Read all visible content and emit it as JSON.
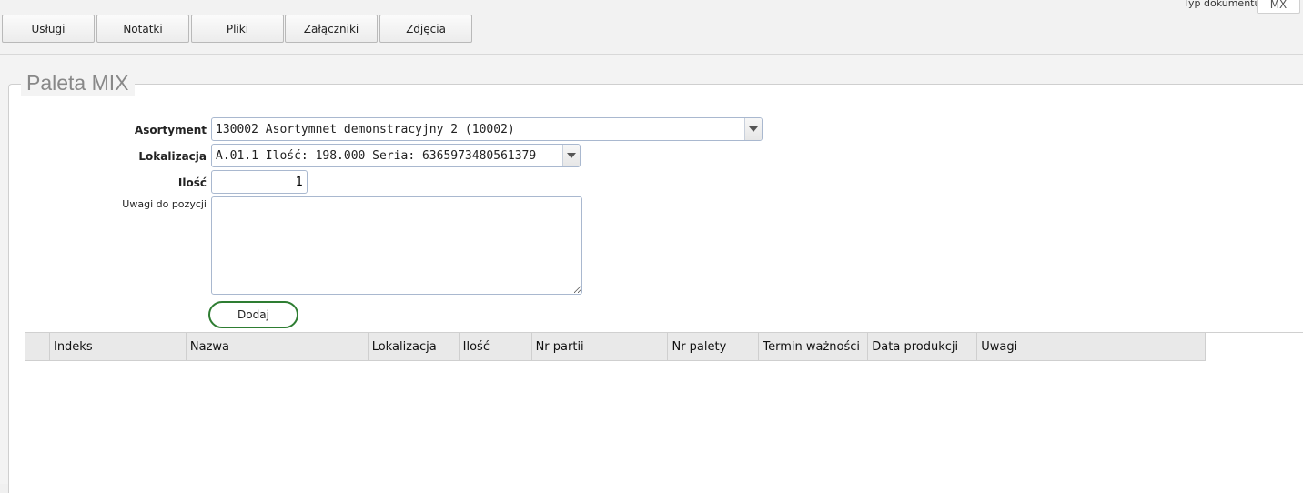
{
  "tabs": [
    {
      "label": "Usługi"
    },
    {
      "label": "Notatki"
    },
    {
      "label": "Pliki"
    },
    {
      "label": "Załączniki"
    },
    {
      "label": "Zdjęcia"
    }
  ],
  "doc_type": {
    "label": "Typ dokumentu",
    "value": "MX"
  },
  "section": {
    "title": "Paleta MIX"
  },
  "form": {
    "assortment": {
      "label": "Asortyment",
      "value": "130002 Asortymnet demonstracyjny 2 (10002)"
    },
    "location": {
      "label": "Lokalizacja",
      "value": "A.01.1 Ilość: 198.000  Seria:  6365973480561379"
    },
    "quantity": {
      "label": "Ilość",
      "value": "1"
    },
    "notes": {
      "label": "Uwagi do pozycji",
      "value": ""
    },
    "add_button": "Dodaj"
  },
  "grid": {
    "columns": [
      {
        "label": ""
      },
      {
        "label": "Indeks"
      },
      {
        "label": "Nazwa"
      },
      {
        "label": "Lokalizacja"
      },
      {
        "label": "Ilość"
      },
      {
        "label": "Nr partii"
      },
      {
        "label": "Nr palety"
      },
      {
        "label": "Termin ważności"
      },
      {
        "label": "Data produkcji"
      },
      {
        "label": "Uwagi"
      }
    ],
    "rows": []
  },
  "colors": {
    "add_button_border": "#2e7d32",
    "input_border": "#a9b8cf"
  }
}
